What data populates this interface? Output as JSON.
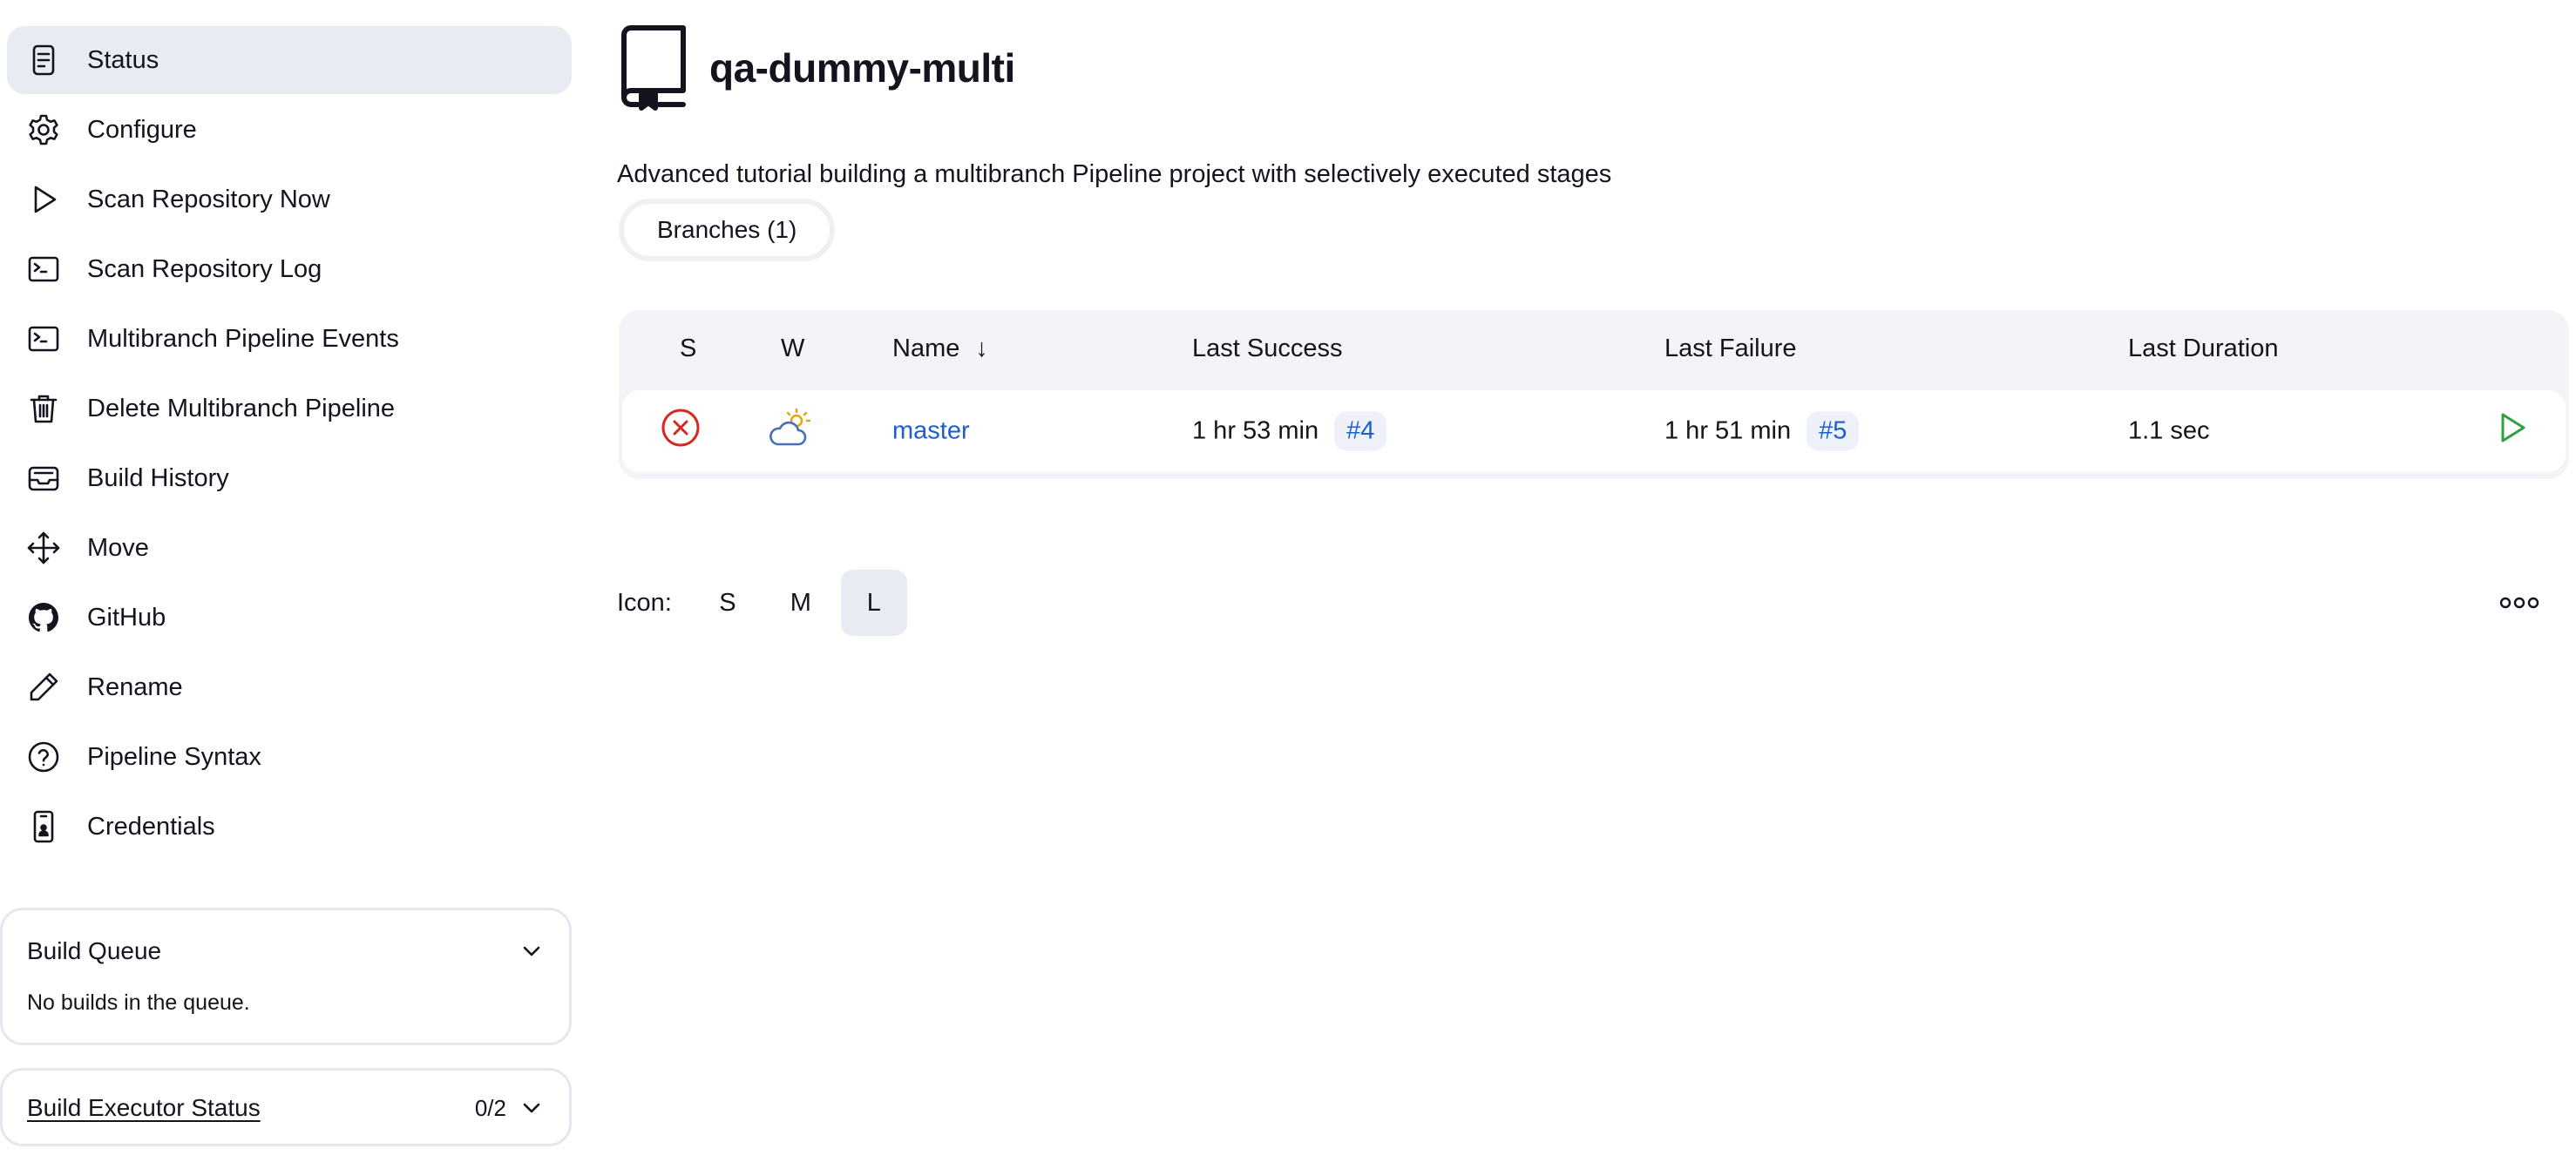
{
  "sidebar": {
    "items": [
      {
        "label": "Status",
        "icon": "status-icon"
      },
      {
        "label": "Configure",
        "icon": "gear-icon"
      },
      {
        "label": "Scan Repository Now",
        "icon": "play-icon"
      },
      {
        "label": "Scan Repository Log",
        "icon": "terminal-icon"
      },
      {
        "label": "Multibranch Pipeline Events",
        "icon": "terminal-icon"
      },
      {
        "label": "Delete Multibranch Pipeline",
        "icon": "trash-icon"
      },
      {
        "label": "Build History",
        "icon": "inbox-icon"
      },
      {
        "label": "Move",
        "icon": "move-icon"
      },
      {
        "label": "GitHub",
        "icon": "github-icon"
      },
      {
        "label": "Rename",
        "icon": "pencil-icon"
      },
      {
        "label": "Pipeline Syntax",
        "icon": "help-icon"
      },
      {
        "label": "Credentials",
        "icon": "credentials-icon"
      }
    ],
    "active_index": 0
  },
  "build_queue": {
    "title": "Build Queue",
    "empty_text": "No builds in the queue."
  },
  "build_executor": {
    "title": "Build Executor Status",
    "count": "0/2"
  },
  "header": {
    "title": "qa-dummy-multi",
    "description": "Advanced tutorial building a multibranch Pipeline project with selectively executed stages"
  },
  "tabs": [
    {
      "label": "Branches (1)"
    }
  ],
  "table": {
    "columns": {
      "s": "S",
      "w": "W",
      "name": "Name",
      "name_sort": "↓",
      "last_success": "Last Success",
      "last_failure": "Last Failure",
      "last_duration": "Last Duration"
    },
    "rows": [
      {
        "status": "failed",
        "weather": "partly-cloudy",
        "name": "master",
        "last_success_time": "1 hr 53 min",
        "last_success_build": "#4",
        "last_failure_time": "1 hr 51 min",
        "last_failure_build": "#5",
        "last_duration": "1.1 sec"
      }
    ]
  },
  "icon_size": {
    "label": "Icon:",
    "options": [
      "S",
      "M",
      "L"
    ],
    "selected": "L"
  },
  "colors": {
    "accent_link": "#1b5fd1",
    "failure": "#d6281f",
    "success_play": "#2ea043",
    "active_bg": "#e8ecf2"
  }
}
